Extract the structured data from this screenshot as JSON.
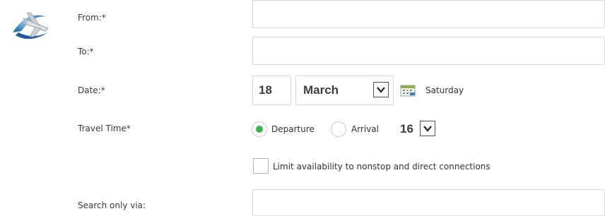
{
  "form": {
    "from_label": "From:*",
    "to_label": "To:*",
    "date_label": "Date:*",
    "travel_time_label": "Travel Time*",
    "search_via_label": "Search only via:"
  },
  "date": {
    "day": "18",
    "month": "March",
    "weekday": "Saturday"
  },
  "travel_time": {
    "options": [
      "Departure",
      "Arrival"
    ],
    "selected": "Departure",
    "hour": "16"
  },
  "limit_checkbox": {
    "label": "Limit availability to nonstop and direct connections",
    "checked": false
  },
  "icons": {
    "logo": "airplane-globe-icon",
    "calendar": "calendar-icon",
    "dropdown": "chevron-down-icon"
  },
  "colors": {
    "radio_selected": "#34b34a",
    "field_border": "#d9dcdf"
  }
}
